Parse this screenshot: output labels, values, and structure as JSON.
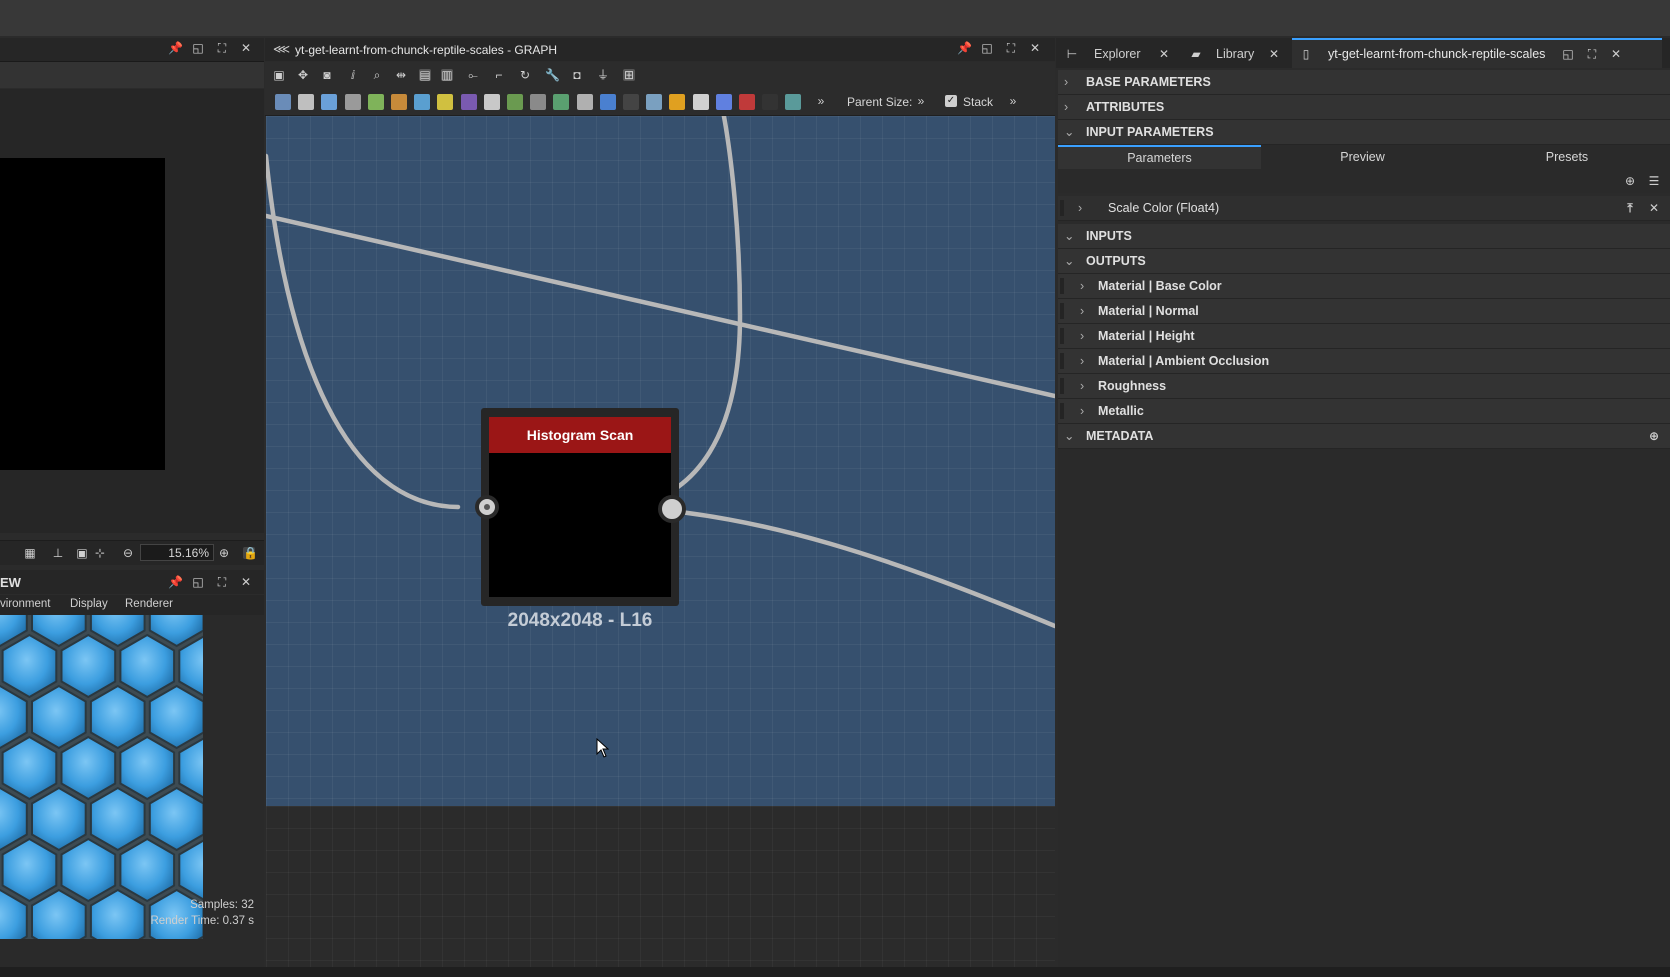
{
  "graph_panel": {
    "title": "yt-get-learnt-from-chunck-reptile-scales - GRAPH",
    "parent_size_label": "Parent Size:",
    "stack_label": "Stack"
  },
  "left_panel": {
    "zoom_value": "15.16%"
  },
  "view3d_panel": {
    "title_fragment": "EW",
    "tabs": [
      "vironment",
      "Display",
      "Renderer"
    ],
    "samples_text": "Samples: 32",
    "render_time_text": "Render Time: 0.37 s"
  },
  "node": {
    "title": "Histogram Scan",
    "resolution": "2048x2048 - L16",
    "header_color": "#9b1616"
  },
  "right_panel": {
    "tabs": {
      "explorer": "Explorer",
      "library": "Library",
      "document": "yt-get-learnt-from-chunck-reptile-scales"
    },
    "sections": {
      "base_parameters": "BASE PARAMETERS",
      "attributes": "ATTRIBUTES",
      "input_parameters": "INPUT PARAMETERS",
      "inputs": "INPUTS",
      "outputs": "OUTPUTS",
      "metadata": "METADATA"
    },
    "sub_tabs": [
      "Parameters",
      "Preview",
      "Presets"
    ],
    "parameter_item": "Scale Color (Float4)",
    "outputs": [
      "Material | Base Color",
      "Material | Normal",
      "Material | Height",
      "Material | Ambient Occlusion",
      "Roughness",
      "Metallic"
    ]
  },
  "colors": {
    "accent": "#3aa0ff",
    "graph_bg": "#36506e",
    "node_header": "#9b1616"
  }
}
